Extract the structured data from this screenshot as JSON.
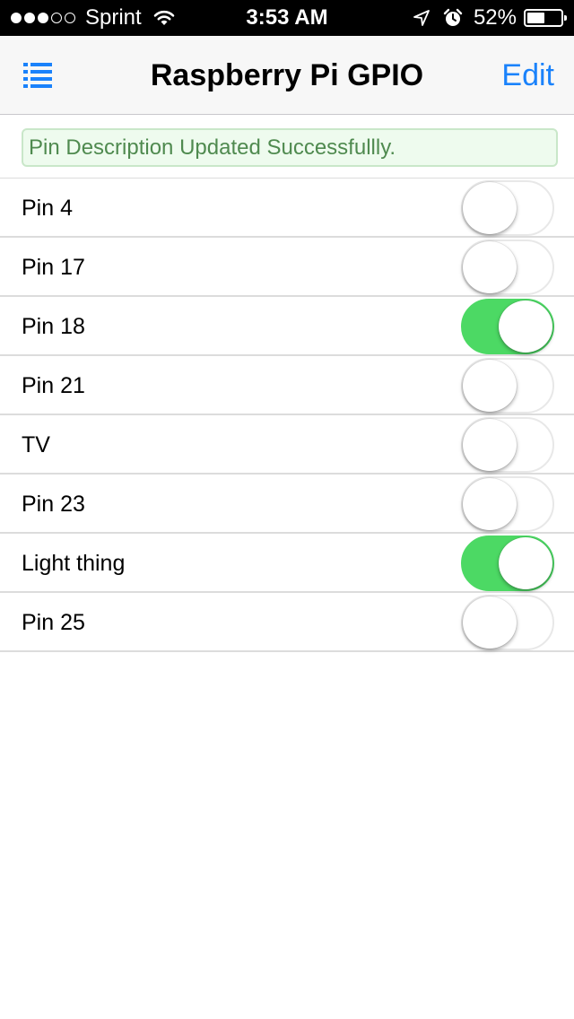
{
  "status_bar": {
    "signal_bars": [
      true,
      true,
      true,
      false,
      false
    ],
    "carrier": "Sprint",
    "time": "3:53 AM",
    "battery_percent_label": "52%",
    "battery_level": 0.52,
    "icons": [
      "signal-dots-icon",
      "wifi-icon",
      "location-arrow-icon",
      "alarm-clock-icon",
      "battery-icon"
    ]
  },
  "nav": {
    "menu_icon": "list-menu-icon",
    "title": "Raspberry Pi GPIO",
    "edit_label": "Edit"
  },
  "alert": {
    "message": "Pin Description Updated Successfullly."
  },
  "pins": [
    {
      "label": "Pin 4",
      "on": false
    },
    {
      "label": "Pin 17",
      "on": false
    },
    {
      "label": "Pin 18",
      "on": true
    },
    {
      "label": "Pin 21",
      "on": false
    },
    {
      "label": "TV",
      "on": false
    },
    {
      "label": "Pin 23",
      "on": false
    },
    {
      "label": "Light thing",
      "on": true
    },
    {
      "label": "Pin 25",
      "on": false
    }
  ],
  "colors": {
    "accent": "#1a82fb",
    "toggle_on": "#4cd964",
    "alert_text": "#4f8a4f",
    "alert_bg": "#eefbee",
    "alert_border": "#c9e7c9"
  }
}
